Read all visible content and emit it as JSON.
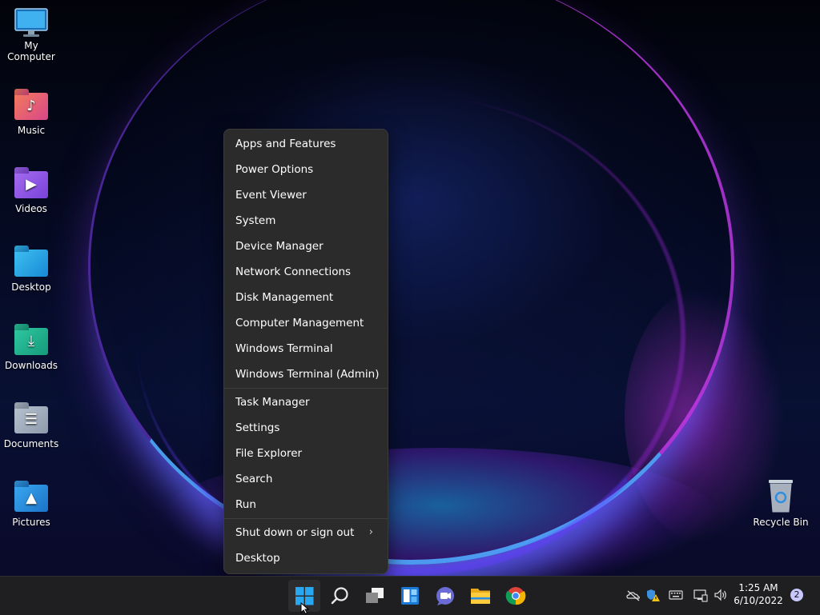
{
  "desktop": {
    "icons": [
      {
        "label": "My Computer",
        "icon": "monitor-icon"
      },
      {
        "label": "Music",
        "icon": "music-folder-icon"
      },
      {
        "label": "Videos",
        "icon": "videos-folder-icon"
      },
      {
        "label": "Desktop",
        "icon": "desktop-folder-icon"
      },
      {
        "label": "Downloads",
        "icon": "downloads-folder-icon"
      },
      {
        "label": "Documents",
        "icon": "documents-folder-icon"
      },
      {
        "label": "Pictures",
        "icon": "pictures-folder-icon"
      }
    ],
    "recycle_bin": {
      "label": "Recycle Bin",
      "icon": "recycle-bin-icon"
    }
  },
  "context_menu": {
    "group1": [
      "Apps and Features",
      "Power Options",
      "Event Viewer",
      "System",
      "Device Manager",
      "Network Connections",
      "Disk Management",
      "Computer Management",
      "Windows Terminal",
      "Windows Terminal (Admin)"
    ],
    "group2": [
      "Task Manager",
      "Settings",
      "File Explorer",
      "Search",
      "Run"
    ],
    "group3": [
      "Shut down or sign out",
      "Desktop"
    ],
    "submenu_chevron": "›"
  },
  "taskbar": {
    "apps": [
      "start-icon",
      "search-icon",
      "task-view-icon",
      "widgets-icon",
      "teams-chat-icon",
      "file-explorer-icon",
      "chrome-icon"
    ],
    "tray_icons": [
      "onedrive-offline-icon",
      "security-warning-icon",
      "keyboard-icon",
      "network-icon",
      "volume-icon"
    ],
    "time": "1:25 AM",
    "date": "6/10/2022",
    "notification_count": "2"
  },
  "colors": {
    "accent": "#4cc2ff",
    "menu_bg": "#2b2b2b",
    "taskbar_bg": "#1f1f21"
  }
}
